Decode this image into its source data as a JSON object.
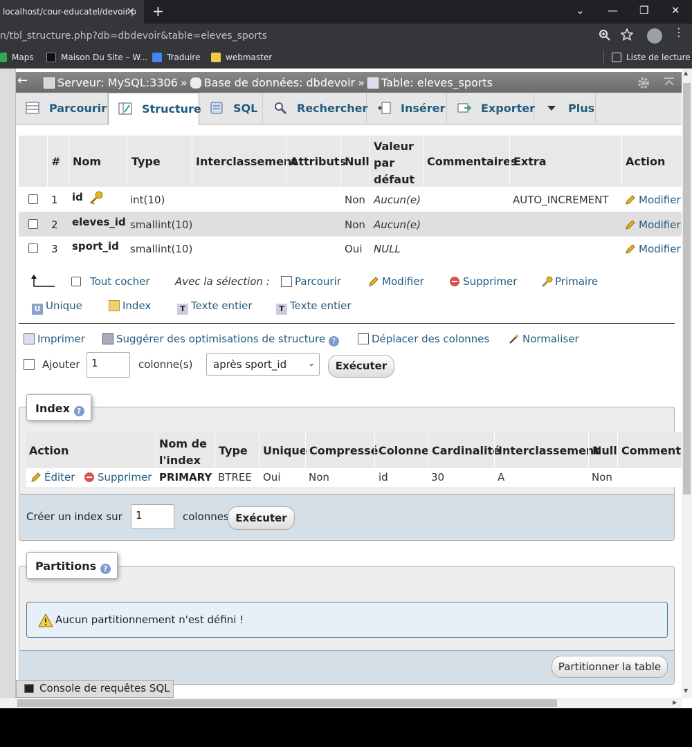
{
  "browser": {
    "tab_title": "localhost/cour-educatel/devoir-p",
    "tab_close": "×",
    "new_tab": "+",
    "url": "n/tbl_structure.php?db=dbdevoir&table=eleves_sports",
    "bookmarks": [
      {
        "label": "Maps"
      },
      {
        "label": "Maison Du Site – W..."
      },
      {
        "label": "Traduire"
      },
      {
        "label": "webmaster"
      }
    ],
    "reading_list": "Liste de lecture",
    "win_min": "—",
    "win_max": "❐",
    "win_close": "✕",
    "chevron": "⌄"
  },
  "breadcrumb": {
    "back": "←",
    "server": "Serveur: MySQL:3306",
    "database": "Base de données: dbdevoir",
    "table": "Table: eleves_sports",
    "sep": "»"
  },
  "tabs": [
    {
      "label": "Parcourir"
    },
    {
      "label": "Structure"
    },
    {
      "label": "SQL"
    },
    {
      "label": "Rechercher"
    },
    {
      "label": "Insérer"
    },
    {
      "label": "Exporter"
    },
    {
      "label": "Plus"
    }
  ],
  "structure": {
    "headers": {
      "num": "#",
      "name": "Nom",
      "type": "Type",
      "collation": "Interclassement",
      "attributes": "Attributs",
      "null": "Null",
      "default_1": "Valeur",
      "default_2": "par",
      "default_3": "défaut",
      "comments": "Commentaires",
      "extra": "Extra",
      "action": "Action"
    },
    "rows": [
      {
        "num": "1",
        "name": "id",
        "type": "int(10)",
        "null": "Non",
        "default": "Aucun(e)",
        "extra": "AUTO_INCREMENT",
        "action": "Modifier"
      },
      {
        "num": "2",
        "name": "eleves_id",
        "type": "smallint(10)",
        "null": "Non",
        "default": "Aucun(e)",
        "extra": "",
        "action": "Modifier"
      },
      {
        "num": "3",
        "name": "sport_id",
        "type": "smallint(10)",
        "null": "Oui",
        "default": "NULL",
        "extra": "",
        "action": "Modifier"
      }
    ],
    "bulk": {
      "check_all": "Tout cocher",
      "with_selection": "Avec la sélection :",
      "browse": "Parcourir",
      "change": "Modifier",
      "drop": "Supprimer",
      "primary": "Primaire",
      "unique": "Unique",
      "index": "Index",
      "fulltext1": "Texte entier",
      "fulltext2": "Texte entier"
    },
    "links": {
      "print": "Imprimer",
      "propose": "Suggérer des optimisations de structure",
      "move": "Déplacer des colonnes",
      "normalize": "Normaliser"
    },
    "add": {
      "label": "Ajouter",
      "count": "1",
      "unit": "colonne(s)",
      "position": "après sport_id",
      "go": "Exécuter"
    }
  },
  "index": {
    "legend": "Index",
    "help": "?",
    "headers": {
      "action": "Action",
      "keyname_1": "Nom de",
      "keyname_2": "l'index",
      "type": "Type",
      "unique": "Unique",
      "packed": "Compressé",
      "column": "Colonne",
      "cardinality": "Cardinalité",
      "collation": "Interclassement",
      "null": "Null",
      "comment": "Commenta"
    },
    "row": {
      "edit": "Éditer",
      "drop": "Supprimer",
      "keyname": "PRIMARY",
      "type": "BTREE",
      "unique": "Oui",
      "packed": "Non",
      "column": "id",
      "cardinality": "30",
      "collation": "A",
      "null": "Non"
    },
    "create": {
      "label": "Créer un index sur",
      "count": "1",
      "unit": "colonnes",
      "go": "Exécuter"
    }
  },
  "partitions": {
    "legend": "Partitions",
    "help": "?",
    "notice": "Aucun partitionnement n'est défini !",
    "button": "Partitionner la table"
  },
  "console": {
    "label": "Console de requêtes SQL"
  },
  "colors": {
    "link": "#235a81",
    "notice_bg": "#e7f0f6",
    "delete_red": "#d9534f",
    "key_yellow": "#e6b422"
  }
}
